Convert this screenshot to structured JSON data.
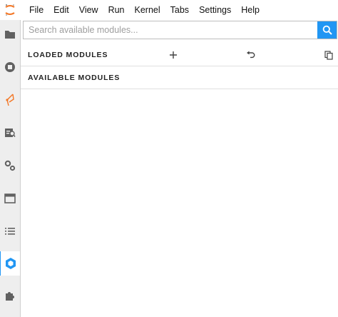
{
  "menubar": {
    "items": [
      "File",
      "Edit",
      "View",
      "Run",
      "Kernel",
      "Tabs",
      "Settings",
      "Help"
    ]
  },
  "sidebar": {
    "icons": [
      "folder-icon",
      "running-icon",
      "git-icon",
      "property-inspector-icon",
      "gear-icon",
      "tabs-icon",
      "toc-icon",
      "modules-icon",
      "extension-icon"
    ],
    "active": "modules-icon"
  },
  "search": {
    "placeholder": "Search available modules..."
  },
  "sections": {
    "loaded": {
      "title": "LOADED MODULES"
    },
    "available": {
      "title": "AVAILABLE MODULES"
    }
  },
  "colors": {
    "accent": "#2196f3",
    "jupyter_orange": "#f37726",
    "icon_gray": "#616161"
  }
}
